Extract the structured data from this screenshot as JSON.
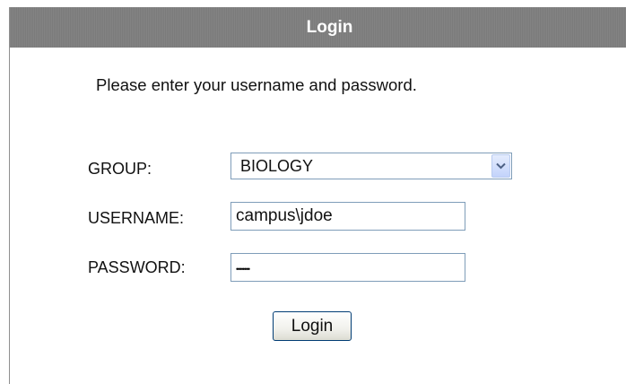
{
  "header": {
    "title": "Login"
  },
  "instructions": "Please enter your username and password.",
  "form": {
    "group_label": "GROUP:",
    "group_value": "BIOLOGY",
    "username_label": "USERNAME:",
    "username_value": "campus\\jdoe",
    "password_label": "PASSWORD:",
    "password_masked": "•••••••",
    "login_button_label": "Login"
  },
  "icons": {
    "dropdown": "chevron-down-icon"
  },
  "colors": {
    "header_bg": "#7f7f7f",
    "header_text": "#ffffff",
    "input_border": "#7f9db9",
    "dropdown_button": "#c3d3fb",
    "button_border": "#003c74"
  }
}
